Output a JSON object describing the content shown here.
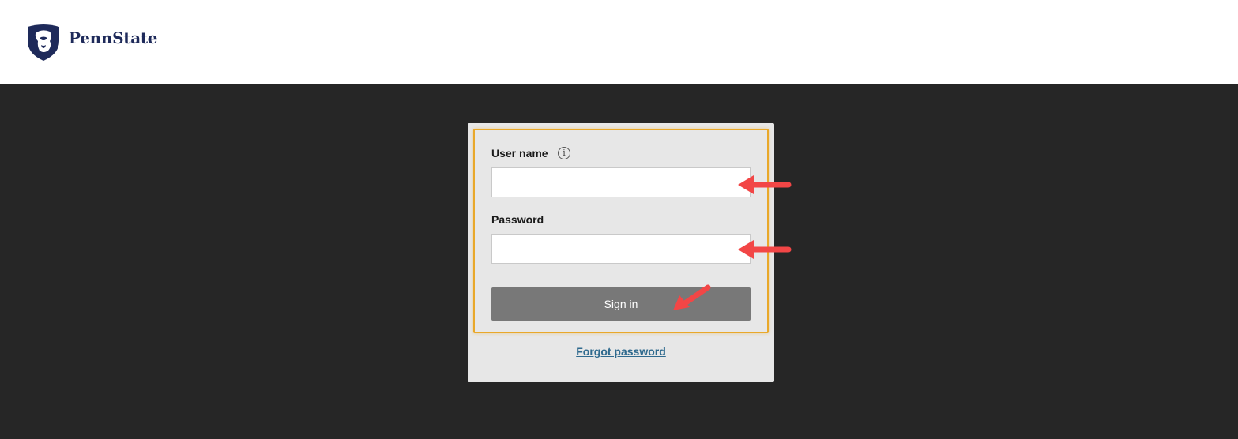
{
  "brand": {
    "name": "PennState",
    "color": "#1e2a5a"
  },
  "login": {
    "username_label": "User name",
    "username_value": "",
    "password_label": "Password",
    "password_value": "",
    "signin_label": "Sign in",
    "forgot_label": "Forgot password"
  },
  "icons": {
    "info": "info-icon",
    "logo": "nittany-lion-shield-icon"
  },
  "colors": {
    "background": "#262626",
    "card": "#e7e7e7",
    "highlight": "#e9a82a",
    "button": "#787878",
    "link": "#2f6a8e",
    "annotation_arrow": "#f24646"
  }
}
